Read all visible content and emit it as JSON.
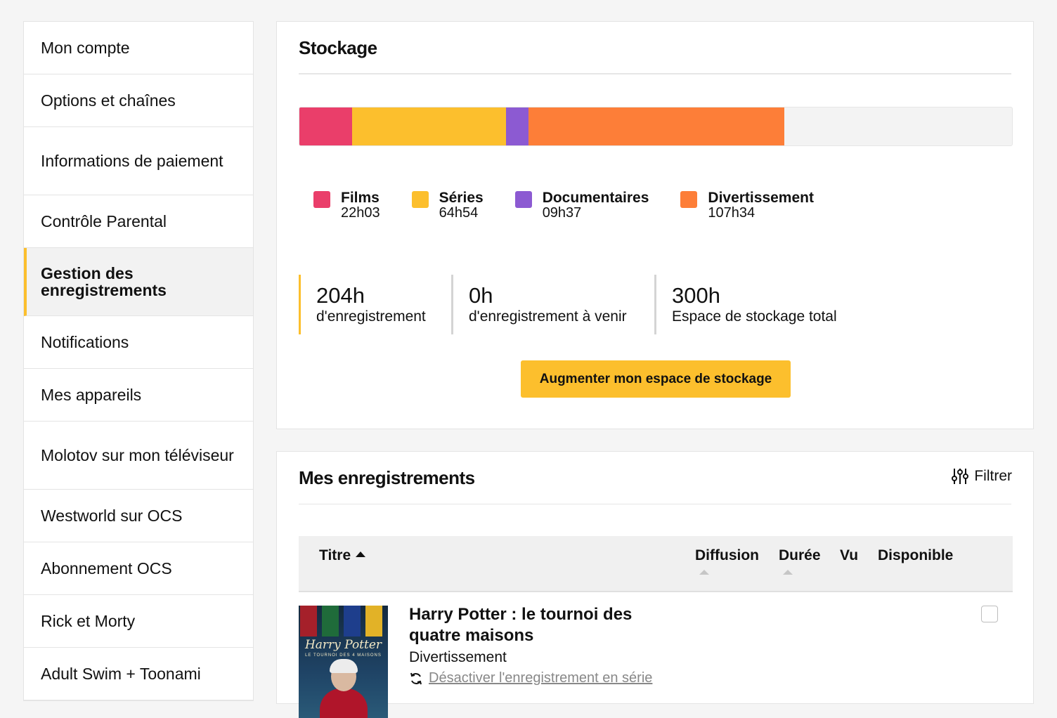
{
  "sidebar": {
    "items": [
      {
        "label": "Mon compte"
      },
      {
        "label": "Options et chaînes"
      },
      {
        "label": "Informations de paiement"
      },
      {
        "label": "Contrôle Parental"
      },
      {
        "label": "Gestion des enregistrements"
      },
      {
        "label": "Notifications"
      },
      {
        "label": "Mes appareils"
      },
      {
        "label": "Molotov sur mon téléviseur"
      },
      {
        "label": "Westworld sur OCS"
      },
      {
        "label": "Abonnement OCS"
      },
      {
        "label": "Rick et Morty"
      },
      {
        "label": "Adult Swim + Toonami"
      }
    ],
    "active_index": 4,
    "accent_color": "#fcbf2d"
  },
  "storage": {
    "title": "Stockage",
    "total_hours": 300,
    "categories": [
      {
        "name": "Films",
        "value": "22h03",
        "hours": 22.05,
        "color": "#ea3e6a"
      },
      {
        "name": "Séries",
        "value": "64h54",
        "hours": 64.9,
        "color": "#fcbf2d"
      },
      {
        "name": "Documentaires",
        "value": "09h37",
        "hours": 9.62,
        "color": "#8c5ad2"
      },
      {
        "name": "Divertissement",
        "value": "107h34",
        "hours": 107.57,
        "color": "#fd7e38"
      }
    ],
    "stats": [
      {
        "number": "204h",
        "label": "d'enregistrement"
      },
      {
        "number": "0h",
        "label": "d'enregistrement à venir"
      },
      {
        "number": "300h",
        "label": "Espace de stockage total"
      }
    ],
    "upgrade_button": "Augmenter mon espace de stockage"
  },
  "recordings": {
    "title": "Mes enregistrements",
    "filter_label": "Filtrer",
    "filter_icon": "sliders-icon",
    "columns": {
      "title": "Titre",
      "broadcast": "Diffusion",
      "duration": "Durée",
      "seen": "Vu",
      "available": "Disponible"
    },
    "rows": [
      {
        "title": "Harry Potter : le tournoi des quatre maisons",
        "genre": "Divertissement",
        "series_action": "Désactiver l'enregistrement en série",
        "series_icon": "refresh-icon",
        "poster_title": "Harry Potter",
        "poster_subtitle": "LE TOURNOI DES 4 MAISONS",
        "checked": false
      }
    ]
  }
}
